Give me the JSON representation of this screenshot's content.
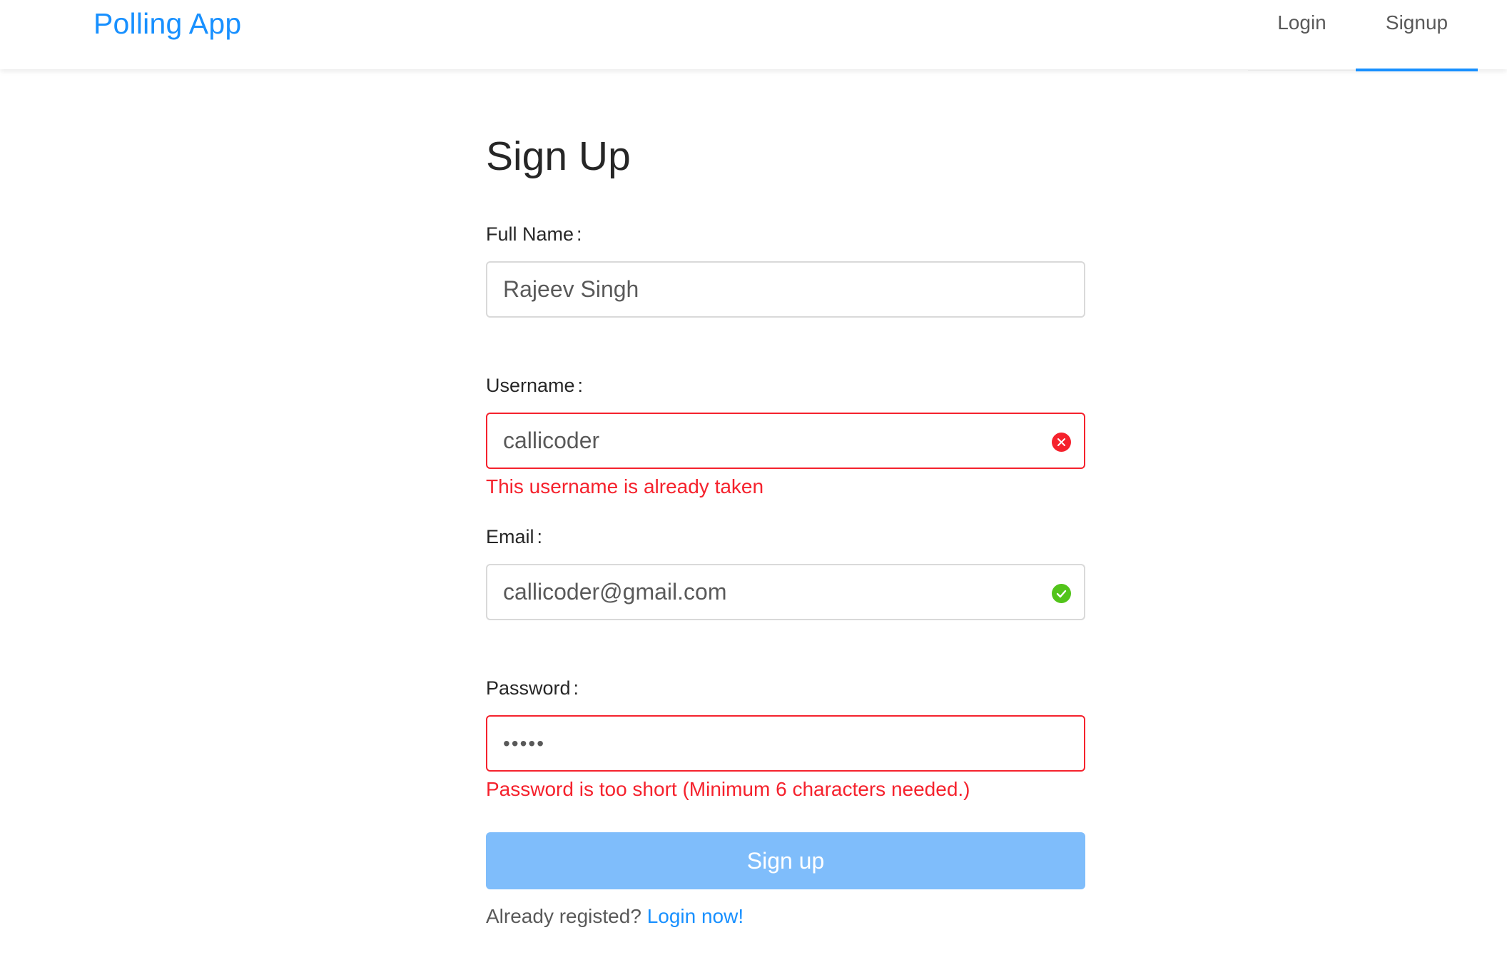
{
  "header": {
    "app_name": "Polling App",
    "nav": [
      {
        "label": "Login",
        "active": false
      },
      {
        "label": "Signup",
        "active": true
      }
    ]
  },
  "form": {
    "title": "Sign Up",
    "fields": {
      "full_name": {
        "label": "Full Name",
        "value": "Rajeev Singh"
      },
      "username": {
        "label": "Username",
        "value": "callicoder",
        "status": "error",
        "help": "This username is already taken"
      },
      "email": {
        "label": "Email",
        "value": "callicoder@gmail.com",
        "status": "success"
      },
      "password": {
        "label": "Password",
        "value": "•••••",
        "status": "error",
        "help": "Password is too short (Minimum 6 characters needed.)"
      }
    },
    "colon": ":",
    "submit_label": "Sign up",
    "footer_text": "Already registed?",
    "footer_link": "Login now!"
  },
  "colors": {
    "primary": "#1890ff",
    "error": "#f5222d",
    "success": "#52c41a",
    "button_disabled": "#7fbdfb"
  },
  "icons": {
    "username_status": "close-circle-icon",
    "email_status": "check-circle-icon"
  }
}
